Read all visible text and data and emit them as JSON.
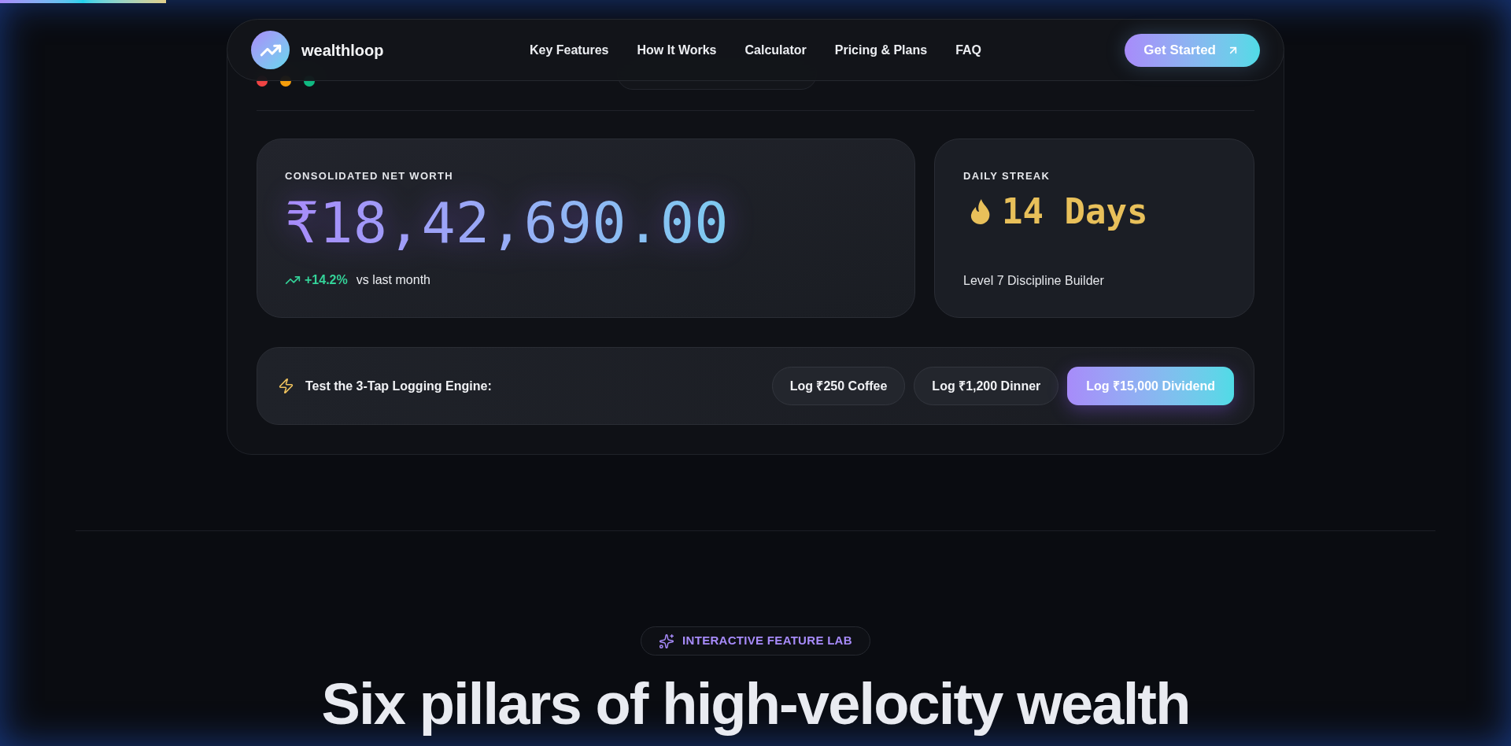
{
  "scroll_progress": {
    "level": 0.11
  },
  "nav": {
    "brand": "wealthloop",
    "links": [
      "Key Features",
      "How It Works",
      "Calculator",
      "Pricing & Plans",
      "FAQ"
    ],
    "cta": "Get Started"
  },
  "dashboard": {
    "window_dots": [
      {
        "color": "#ef4444"
      },
      {
        "color": "#f59e0b"
      },
      {
        "color": "#10b981"
      }
    ],
    "net_worth": {
      "label": "CONSOLIDATED NET WORTH",
      "amount": "₹18,42,690.00",
      "change": "+14.2%",
      "change_note": "vs last month"
    },
    "streak": {
      "label": "DAILY STREAK",
      "value": "14 Days",
      "note": "Level 7 Discipline Builder"
    },
    "logging": {
      "label": "Test the 3-Tap Logging Engine:",
      "buttons": [
        {
          "label": "Log ₹250 Coffee",
          "selected": false
        },
        {
          "label": "Log ₹1,200 Dinner",
          "selected": false
        },
        {
          "label": "Log ₹15,000 Dividend",
          "selected": true
        }
      ]
    }
  },
  "feature_lab": {
    "badge": "INTERACTIVE FEATURE LAB",
    "heading": "Six pillars of high-velocity wealth"
  }
}
